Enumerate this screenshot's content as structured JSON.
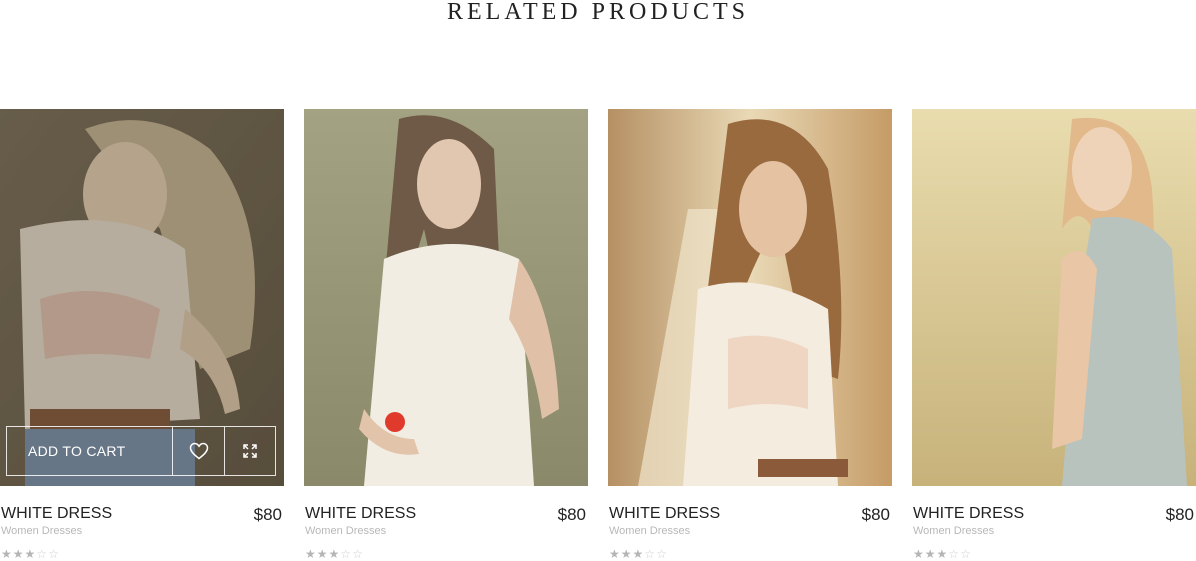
{
  "section": {
    "title": "RELATED PRODUCTS"
  },
  "hover_actions": {
    "add_to_cart_label": "ADD TO CART"
  },
  "rating_glyphs": {
    "filled": "★",
    "empty": "☆"
  },
  "products": [
    {
      "name": "WHITE DRESS",
      "price": "$80",
      "category": "Women Dresses",
      "rating": 3,
      "rating_max": 5,
      "hovered": true
    },
    {
      "name": "WHITE DRESS",
      "price": "$80",
      "category": "Women Dresses",
      "rating": 3,
      "rating_max": 5,
      "hovered": false
    },
    {
      "name": "WHITE DRESS",
      "price": "$80",
      "category": "Women Dresses",
      "rating": 3,
      "rating_max": 5,
      "hovered": false
    },
    {
      "name": "WHITE DRESS",
      "price": "$80",
      "category": "Women Dresses",
      "rating": 3,
      "rating_max": 5,
      "hovered": false
    }
  ],
  "icons": {
    "wishlist": "heart-icon",
    "quick_view": "expand-icon"
  },
  "colors": {
    "text": "#222222",
    "muted": "#b8b8b8",
    "star": "#b5b5b5"
  }
}
